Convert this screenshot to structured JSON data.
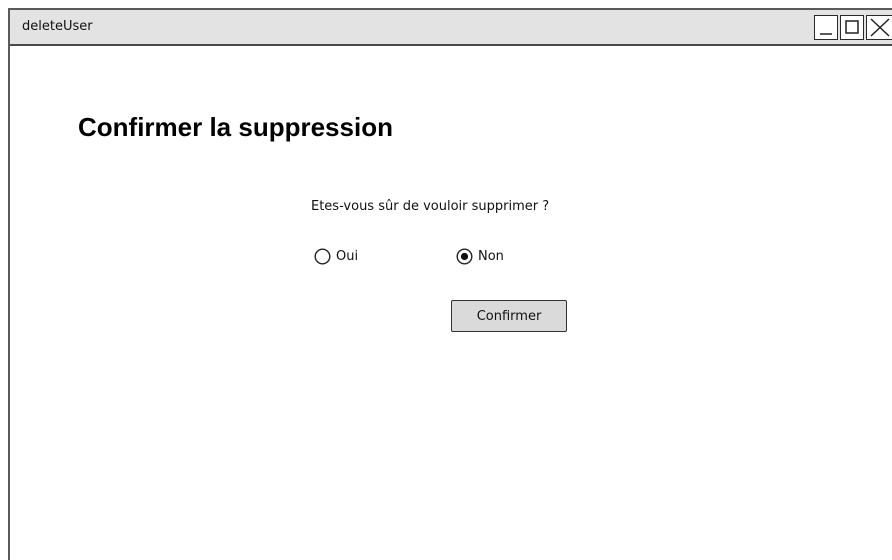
{
  "window": {
    "title": "deleteUser"
  },
  "dialog": {
    "heading": "Confirmer la suppression",
    "question": "Etes-vous sûr de vouloir supprimer ?",
    "options": [
      {
        "label": "Oui",
        "selected": false
      },
      {
        "label": "Non",
        "selected": true
      }
    ],
    "confirm_label": "Confirmer"
  },
  "colors": {
    "titlebar_bg": "#e3e3e3",
    "button_bg": "#dadada",
    "border": "#333333"
  }
}
